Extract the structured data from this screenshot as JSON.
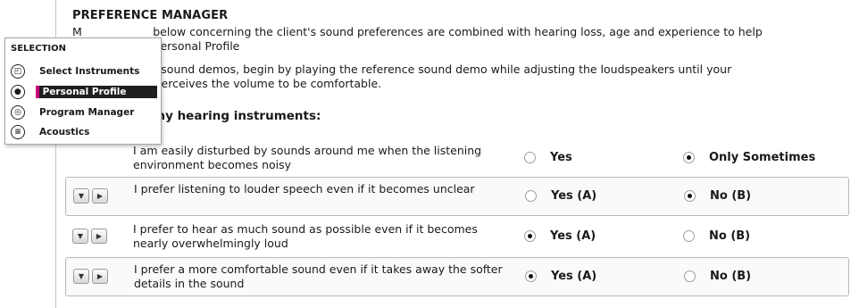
{
  "panel": {
    "title": "PREFERENCE MANAGER",
    "para1_line1": "M                    below concerning the client's sound preferences are combined with hearing loss, age and experience to help",
    "para1_line2": "                       Personal Profile",
    "para2_line1": "                    ng sound demos, begin by playing the reference sound demo while adjusting the loudspeakers until your",
    "para2_line2": "                     : perceives the volume to be comfortable.",
    "subtitle": "my hearing instruments:"
  },
  "questions": [
    {
      "text": "I am easily disturbed by sounds around me when the listening environment becomes noisy",
      "opt_a": "Yes",
      "opt_b": "Only Sometimes",
      "selected": "b",
      "boxed": false,
      "controls": false
    },
    {
      "text": "I prefer listening to louder speech even if it becomes unclear",
      "opt_a": "Yes (A)",
      "opt_b": "No (B)",
      "selected": "b",
      "boxed": true,
      "controls": true
    },
    {
      "text": "I prefer to hear as much sound as possible even if it becomes nearly overwhelmingly loud",
      "opt_a": "Yes (A)",
      "opt_b": "No (B)",
      "selected": "a",
      "boxed": false,
      "controls": true
    },
    {
      "text": "I prefer a more comfortable sound even if it takes away the softer details in the sound",
      "opt_a": "Yes (A)",
      "opt_b": "No (B)",
      "selected": "a",
      "boxed": true,
      "controls": true
    }
  ],
  "selection": {
    "title": "SELECTION",
    "items": [
      {
        "label": "Select Instruments",
        "icon": "hearing-aid-icon"
      },
      {
        "label": "Personal Profile",
        "icon": "person-icon",
        "active": true
      },
      {
        "label": "Program Manager",
        "icon": "program-icon"
      },
      {
        "label": "Acoustics",
        "icon": "acoustics-icon"
      }
    ]
  },
  "colors": {
    "accent": "#c8007a"
  }
}
